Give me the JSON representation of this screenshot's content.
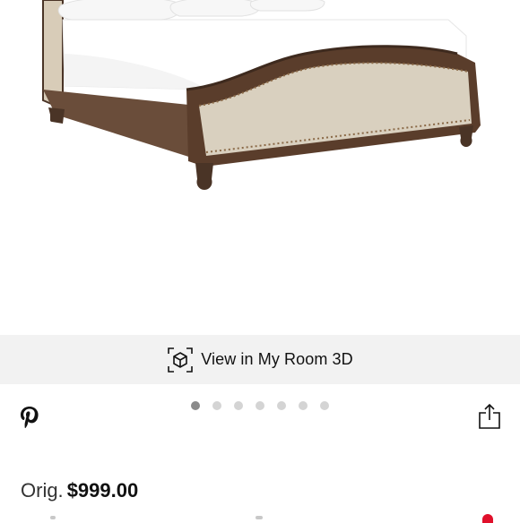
{
  "product": {
    "image_alt": "Upholstered bed with wood frame and nailhead trim"
  },
  "view_in_room": {
    "label": "View in My Room 3D",
    "icon": "3d-cube-icon"
  },
  "carousel": {
    "total": 7,
    "active_index": 0
  },
  "social": {
    "pinterest_icon": "pinterest-icon",
    "share_icon": "share-icon"
  },
  "price": {
    "orig_label": "Orig.",
    "orig_value": "$999.00"
  },
  "colors": {
    "view_bar_bg": "#f2f2f2",
    "dot_active": "#8a8a8a",
    "dot_inactive": "#d4d4d4",
    "badge": "#e0102b"
  }
}
